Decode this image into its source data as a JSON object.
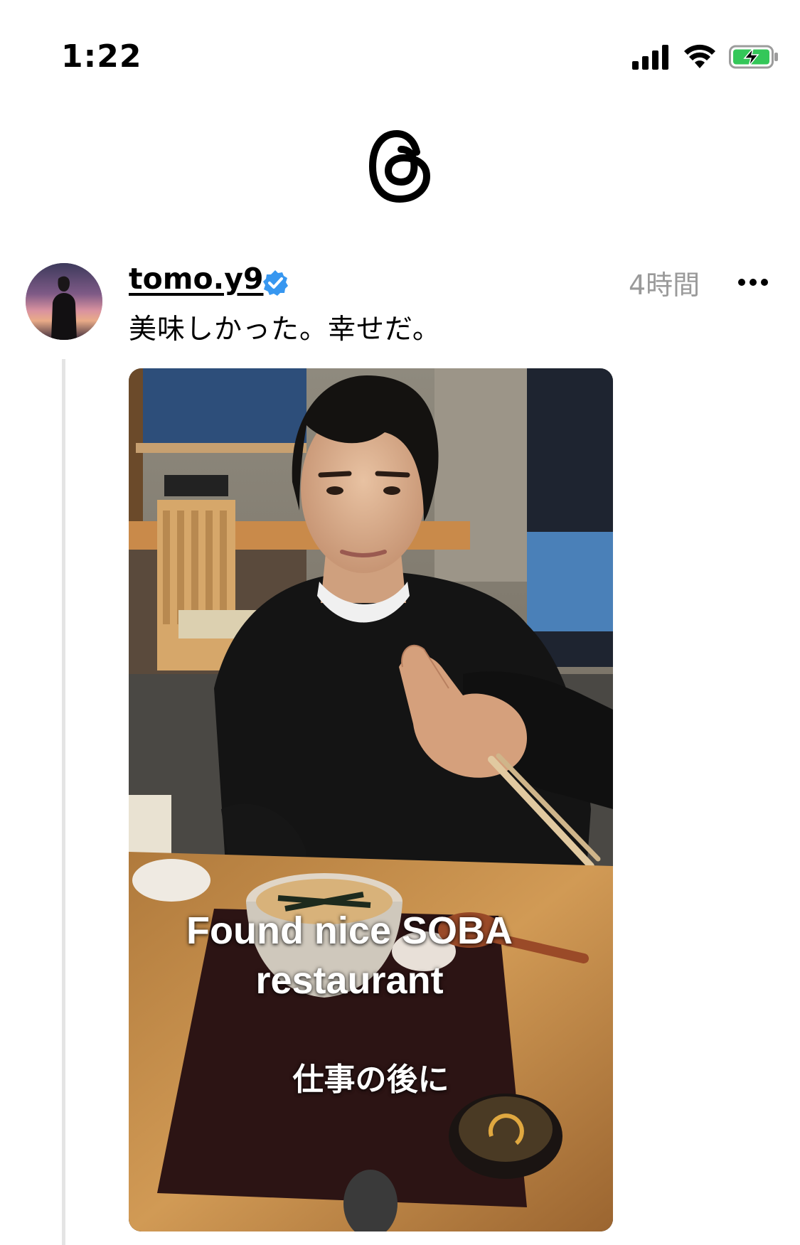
{
  "status_bar": {
    "time": "1:22",
    "battery_color": "#34c759"
  },
  "app": {
    "logo_icon": "threads-logo-icon"
  },
  "post": {
    "username": "tomo.y9",
    "verified_icon": "verified-badge-icon",
    "verified_color": "#3797f0",
    "time": "4時間",
    "text": "美味しかった。幸せだ。",
    "more_icon": "more-options-icon",
    "media": {
      "caption_line_1": "Found nice SOBA",
      "caption_line_2": "restaurant",
      "caption_line_3": "仕事の後に"
    }
  }
}
